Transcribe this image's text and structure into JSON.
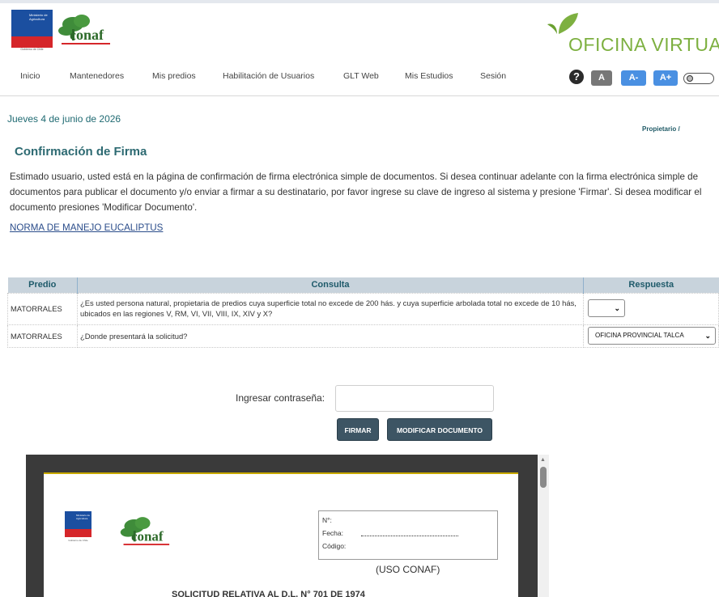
{
  "header": {
    "ministry_logo_text": "Ministerio de Agricultura",
    "ministry_logo_sub": "Gobierno de Chile",
    "conaf_logo_text": "conaf",
    "oficina_brand": "OFICINA VIRTUAL"
  },
  "nav": {
    "items": [
      "Inicio",
      "Mantenedores",
      "Mis predios",
      "Habilitación de Usuarios",
      "GLT Web",
      "Mis Estudios",
      "Sesión"
    ],
    "font_buttons": [
      "A",
      "A-",
      "A+"
    ],
    "help_glyph": "?"
  },
  "page": {
    "date": "Jueves 4 de junio de 2026",
    "breadcrumb": "Propietario /",
    "title": "Confirmación de Firma",
    "instructions": "Estimado usuario, usted está en la página de confirmación de firma electrónica simple de documentos. Si desea continuar adelante con la firma electrónica simple de documentos para publicar el documento y/o enviar a firmar a su destinatario, por favor ingrese su clave de ingreso al sistema y presione 'Firmar'. Si desea modificar el documento presiones 'Modificar Documento'.",
    "document_link": "NORMA DE MANEJO EUCALIPTUS"
  },
  "table": {
    "headers": [
      "Predio",
      "Consulta",
      "Respuesta"
    ],
    "rows": [
      {
        "predio": "MATORRALES",
        "consulta": "¿Es usted persona natural, propietaria de predios cuya superficie total no excede de 200 hás. y cuya superficie arbolada total no excede de 10 hás, ubicados en las regiones V, RM, VI, VII, VIII, IX, XIV y X?",
        "respuesta": ""
      },
      {
        "predio": "MATORRALES",
        "consulta": "¿Donde presentará la solicitud?",
        "respuesta": "OFICINA PROVINCIAL TALCA"
      }
    ]
  },
  "signature": {
    "password_label": "Ingresar contraseña:",
    "password_value": "",
    "sign_button": "FIRMAR",
    "modify_button": "MODIFICAR DOCUMENTO"
  },
  "preview": {
    "box_labels": [
      "N°:",
      "Fecha:",
      "Código:"
    ],
    "uso": "(USO CONAF)",
    "heading": "SOLICITUD RELATIVA AL D.L. N° 701 DE 1974"
  },
  "colors": {
    "accent_teal": "#2d6a72",
    "brand_green": "#7db040",
    "button_dark": "#3d5564",
    "font_btn_gray": "#777777",
    "font_btn_blue": "#4a90e2"
  }
}
